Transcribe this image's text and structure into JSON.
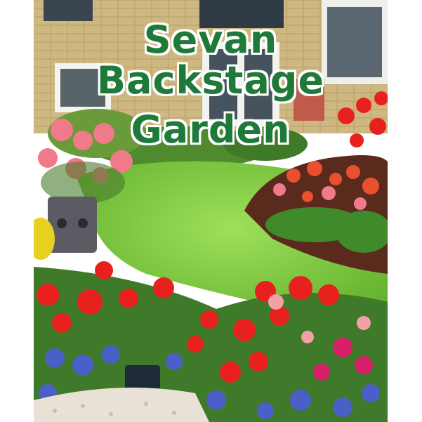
{
  "cover": {
    "title_line1": "Sevan Backstage",
    "title_line2": "Garden"
  },
  "colors": {
    "title_text": "#1f7a3a",
    "title_outline": "#ffffff",
    "lawn": "#7cc83a",
    "house_stone": "#c9b27a",
    "flower_red": "#e8201e",
    "flower_pink": "#f07a8a",
    "flower_blue": "#4a5fc8"
  }
}
